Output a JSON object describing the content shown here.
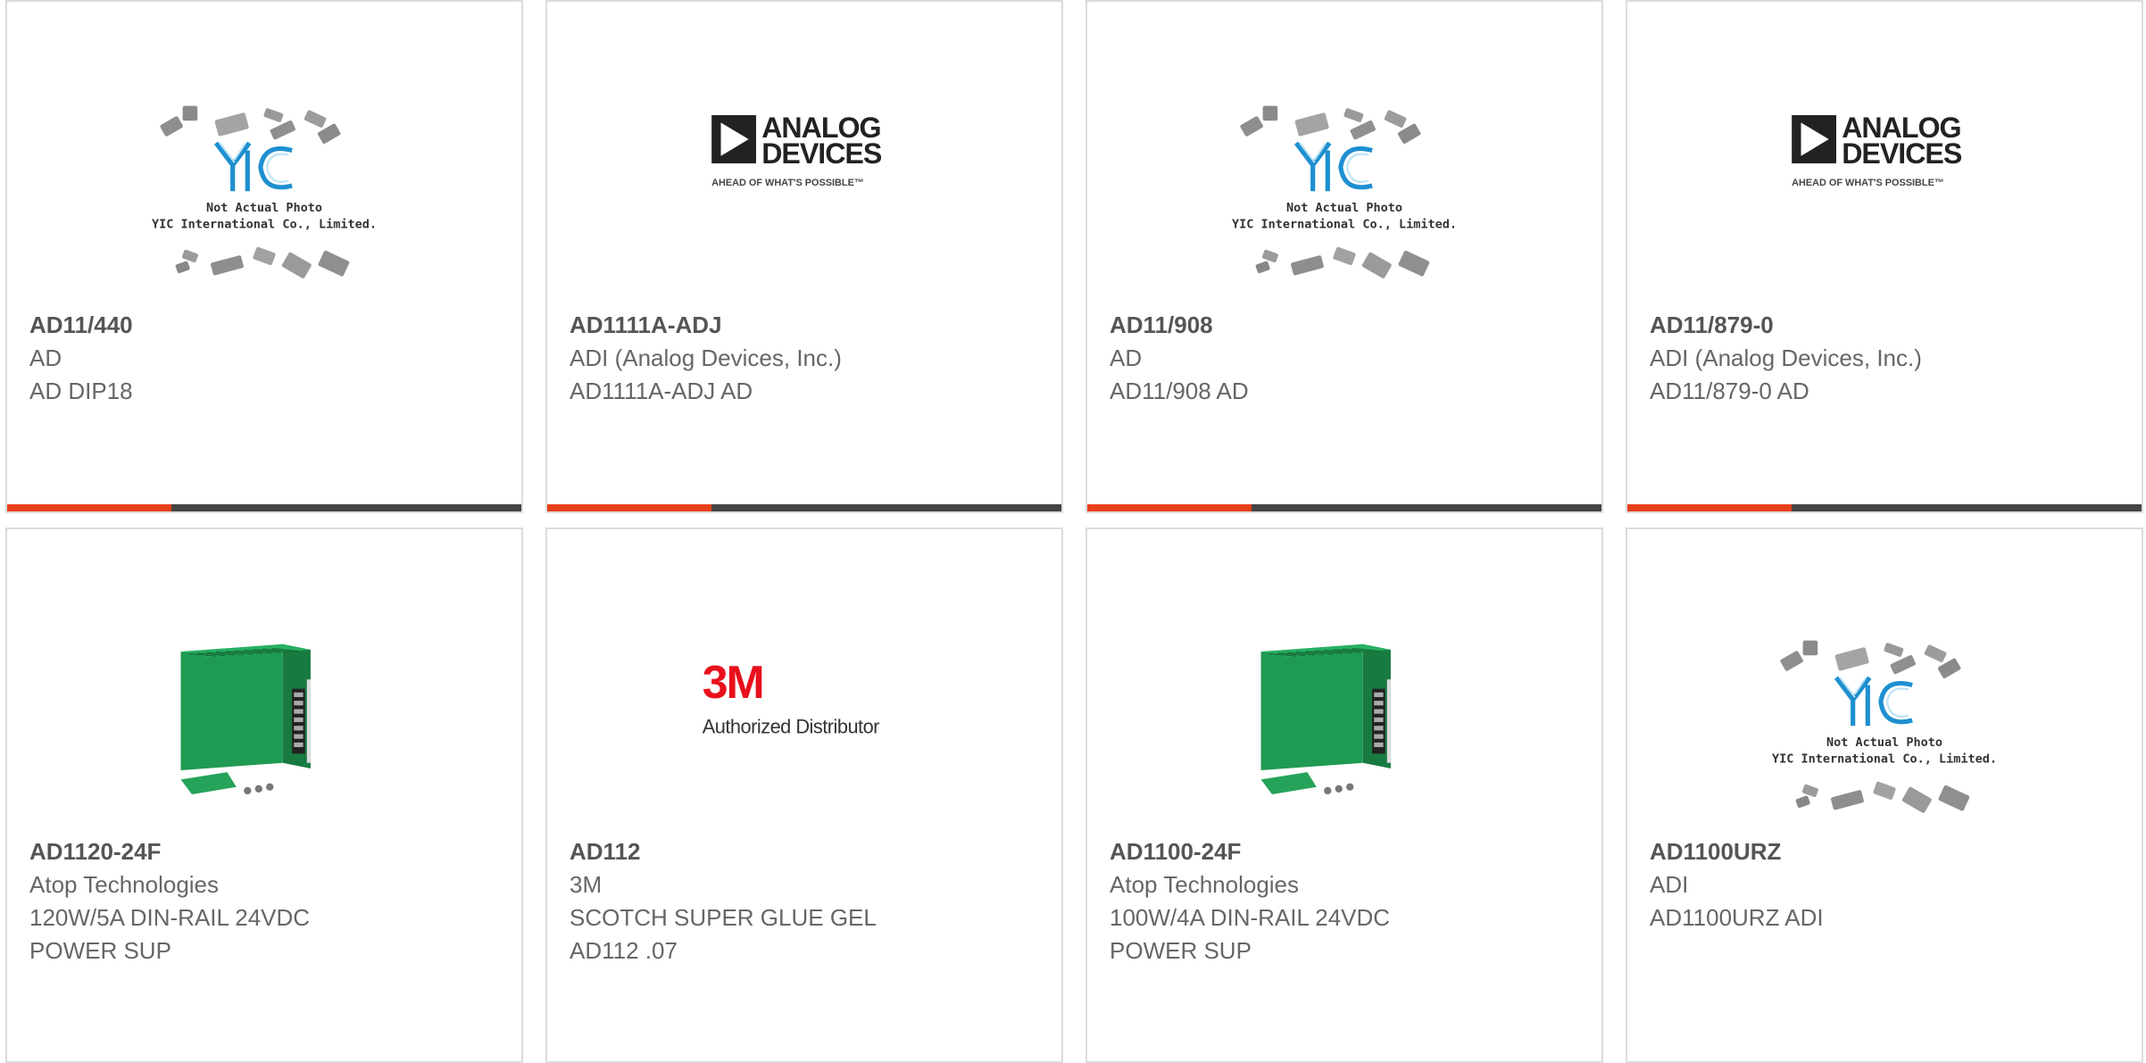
{
  "colors": {
    "card_border": "#dcdcdc",
    "bar_dark": "#444444",
    "bar_accent": "#e8401c",
    "text": "#555555",
    "adi_text": "#222222",
    "yic_blue": "#1e90d0",
    "threem_red": "#e8101c",
    "psu_green": "#1f9a52"
  },
  "products": [
    {
      "part_number": "AD11/440",
      "manufacturer": "AD",
      "description_lines": [
        "AD DIP18"
      ],
      "image_type": "yic-placeholder-icon",
      "progress": 0.32,
      "image": {
        "line1": "Not Actual Photo",
        "line2": "YIC International Co., Limited."
      }
    },
    {
      "part_number": "AD1111A-ADJ",
      "manufacturer": "ADI (Analog Devices, Inc.)",
      "description_lines": [
        "AD1111A-ADJ AD"
      ],
      "image_type": "analog-devices-logo-icon",
      "progress": 0.32,
      "image": {
        "line1": "ANALOG",
        "line2": "DEVICES",
        "tagline": "AHEAD OF WHAT'S POSSIBLE™"
      }
    },
    {
      "part_number": "AD11/908",
      "manufacturer": "AD",
      "description_lines": [
        "AD11/908 AD"
      ],
      "image_type": "yic-placeholder-icon",
      "progress": 0.32,
      "image": {
        "line1": "Not Actual Photo",
        "line2": "YIC International Co., Limited."
      }
    },
    {
      "part_number": "AD11/879-0",
      "manufacturer": "ADI (Analog Devices, Inc.)",
      "description_lines": [
        "AD11/879-0 AD"
      ],
      "image_type": "analog-devices-logo-icon",
      "progress": 0.32,
      "image": {
        "line1": "ANALOG",
        "line2": "DEVICES",
        "tagline": "AHEAD OF WHAT'S POSSIBLE™"
      }
    },
    {
      "part_number": "AD1120-24F",
      "manufacturer": "Atop Technologies",
      "description_lines": [
        "120W/5A DIN-RAIL 24VDC",
        "POWER SUP"
      ],
      "image_type": "power-supply-photo-icon",
      "image": {}
    },
    {
      "part_number": "AD112",
      "manufacturer": "3M",
      "description_lines": [
        "SCOTCH SUPER GLUE GEL",
        "AD112 .07"
      ],
      "image_type": "3m-logo-icon",
      "image": {
        "brand": "3M",
        "caption": "Authorized Distributor"
      }
    },
    {
      "part_number": "AD1100-24F",
      "manufacturer": "Atop Technologies",
      "description_lines": [
        "100W/4A DIN-RAIL 24VDC",
        "POWER SUP"
      ],
      "image_type": "power-supply-photo-icon",
      "image": {}
    },
    {
      "part_number": "AD1100URZ",
      "manufacturer": "ADI",
      "description_lines": [
        "AD1100URZ ADI"
      ],
      "image_type": "yic-placeholder-icon",
      "image": {
        "line1": "Not Actual Photo",
        "line2": "YIC International Co., Limited."
      }
    }
  ]
}
